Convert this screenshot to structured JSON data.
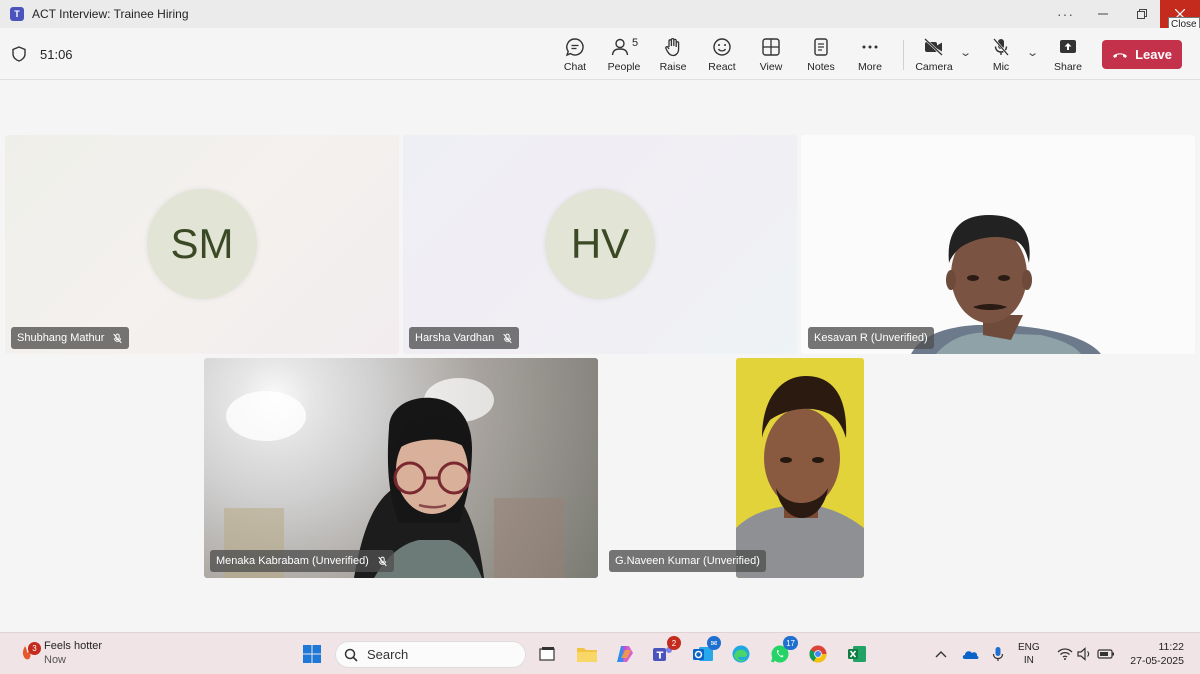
{
  "window": {
    "title": "ACT Interview: Trainee Hiring",
    "tooltip": "Close"
  },
  "meeting": {
    "timer": "51:06",
    "people_count": "5"
  },
  "toolbar": {
    "chat": "Chat",
    "people": "People",
    "raise": "Raise",
    "react": "React",
    "view": "View",
    "notes": "Notes",
    "more": "More",
    "camera": "Camera",
    "mic": "Mic",
    "share": "Share",
    "leave": "Leave"
  },
  "participants": [
    {
      "name": "Shubhang Mathur",
      "initials": "SM",
      "muted": true
    },
    {
      "name": "Harsha Vardhan",
      "initials": "HV",
      "muted": true
    },
    {
      "name": "Kesavan R (Unverified)",
      "muted": false
    },
    {
      "name": "Menaka Kabrabam (Unverified)",
      "muted": true
    },
    {
      "name": "G.Naveen Kumar (Unverified)",
      "muted": false
    }
  ],
  "taskbar": {
    "weather_title": "Feels hotter",
    "weather_sub": "Now",
    "weather_badge": "3",
    "search_placeholder": "Search",
    "teams_badge": "2",
    "whatsapp_badge": "17",
    "lang_line1": "ENG",
    "lang_line2": "IN",
    "time": "11:22",
    "date": "27-05-2025"
  },
  "colors": {
    "leave": "#c4314b",
    "teams_accent": "#4b53bc",
    "close": "#c42b1c"
  }
}
